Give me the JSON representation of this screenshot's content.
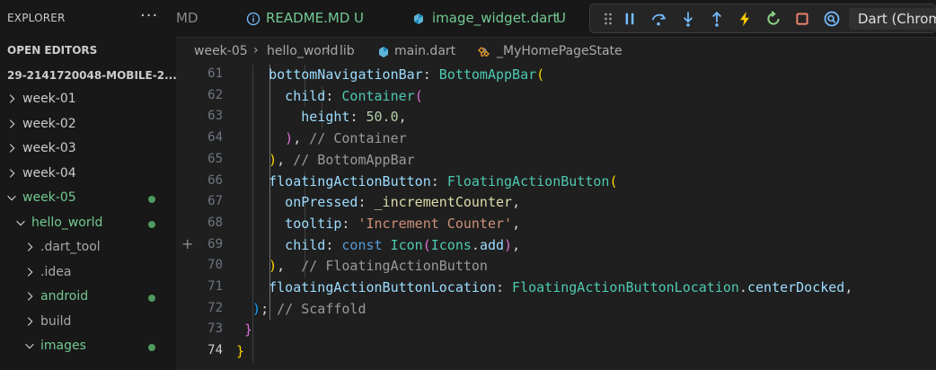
{
  "colors": {
    "sidebar_bg": "#181818",
    "editor_bg": "#1f1f1f",
    "text": "#cccccc",
    "modified_green": "#73c991",
    "dot_green": "#4e9a5f",
    "folder_grey": "#a8a8a8",
    "keyword_blue": "#9cdcfe",
    "class_teal": "#4ec9b0",
    "string_orange": "#ce9178",
    "number_green": "#b5cea8",
    "comment_grey": "#9a9a9a",
    "bracket_gold": "#ffd700",
    "bracket_pink": "#da70d6",
    "bracket_blue": "#179fff",
    "const_blue": "#569cd6",
    "debug_blue": "#75beff",
    "debug_orange": "#ffcc00",
    "debug_green": "#89d185",
    "debug_red": "#f48771"
  },
  "sidebar": {
    "title": "EXPLORER",
    "more_icon": "ellipsis-icon",
    "more_label": "···",
    "open_editors_label": "OPEN EDITORS",
    "root_folder_label": "29-2141720048-MOBILE-2...",
    "items": [
      {
        "label": "week-01",
        "depth": 0,
        "expanded": false,
        "modified": false,
        "color": "#cccccc",
        "dot": false
      },
      {
        "label": "week-02",
        "depth": 0,
        "expanded": false,
        "modified": false,
        "color": "#cccccc",
        "dot": false
      },
      {
        "label": "week-03",
        "depth": 0,
        "expanded": false,
        "modified": false,
        "color": "#cccccc",
        "dot": false
      },
      {
        "label": "week-04",
        "depth": 0,
        "expanded": false,
        "modified": false,
        "color": "#cccccc",
        "dot": false
      },
      {
        "label": "week-05",
        "depth": 0,
        "expanded": true,
        "modified": true,
        "color": "#73c991",
        "dot": true
      },
      {
        "label": "hello_world",
        "depth": 1,
        "expanded": true,
        "modified": true,
        "color": "#73c991",
        "dot": true
      },
      {
        "label": ".dart_tool",
        "depth": 2,
        "expanded": false,
        "modified": false,
        "color": "#a8a8a8",
        "dot": false
      },
      {
        "label": ".idea",
        "depth": 2,
        "expanded": false,
        "modified": false,
        "color": "#a8a8a8",
        "dot": false
      },
      {
        "label": "android",
        "depth": 2,
        "expanded": false,
        "modified": true,
        "color": "#73c991",
        "dot": true
      },
      {
        "label": "build",
        "depth": 2,
        "expanded": false,
        "modified": false,
        "color": "#a8a8a8",
        "dot": false
      },
      {
        "label": "images",
        "depth": 2,
        "expanded": true,
        "modified": true,
        "color": "#73c991",
        "dot": true
      }
    ]
  },
  "tabs": [
    {
      "label": "MD",
      "icon": "",
      "modified_mark": "",
      "color": "#8a8a8a"
    },
    {
      "label": "README.MD",
      "icon": "info-icon",
      "modified_mark": "U",
      "color": "#73c991"
    },
    {
      "label": "image_widget.dart",
      "icon": "dart-icon",
      "modified_mark": "U",
      "color": "#73c991"
    }
  ],
  "debug_toolbar": {
    "target_label": "Dart (Chrome)",
    "buttons": [
      "drag-handle-icon",
      "pause-icon",
      "step-over-icon",
      "step-into-icon",
      "step-out-icon",
      "hot-reload-icon",
      "restart-icon",
      "stop-icon",
      "devtools-icon"
    ]
  },
  "breadcrumb": {
    "parts": [
      "week-05",
      "hello_world",
      "lib",
      "main.dart",
      "_MyHomePageState"
    ]
  },
  "editor": {
    "current_line": 74,
    "lines": [
      {
        "num": 61,
        "tokens": [
          {
            "t": "    bottomNavigationBar",
            "c": "#9cdcfe"
          },
          {
            "t": ": ",
            "c": "#d4d4d4"
          },
          {
            "t": "BottomAppBar",
            "c": "#4ec9b0"
          },
          {
            "t": "(",
            "c": "#ffd700"
          }
        ]
      },
      {
        "num": 62,
        "tokens": [
          {
            "t": "      child",
            "c": "#9cdcfe"
          },
          {
            "t": ": ",
            "c": "#d4d4d4"
          },
          {
            "t": "Container",
            "c": "#4ec9b0"
          },
          {
            "t": "(",
            "c": "#da70d6"
          }
        ]
      },
      {
        "num": 63,
        "tokens": [
          {
            "t": "        height",
            "c": "#9cdcfe"
          },
          {
            "t": ": ",
            "c": "#d4d4d4"
          },
          {
            "t": "50.0",
            "c": "#b5cea8"
          },
          {
            "t": ",",
            "c": "#d4d4d4"
          }
        ]
      },
      {
        "num": 64,
        "tokens": [
          {
            "t": "      )",
            "c": "#da70d6"
          },
          {
            "t": ", ",
            "c": "#d4d4d4"
          },
          {
            "t": "// Container",
            "c": "#9a9a9a"
          }
        ]
      },
      {
        "num": 65,
        "tokens": [
          {
            "t": "    )",
            "c": "#ffd700"
          },
          {
            "t": ", ",
            "c": "#d4d4d4"
          },
          {
            "t": "// BottomAppBar",
            "c": "#9a9a9a"
          }
        ]
      },
      {
        "num": 66,
        "tokens": [
          {
            "t": "    floatingActionButton",
            "c": "#9cdcfe"
          },
          {
            "t": ": ",
            "c": "#d4d4d4"
          },
          {
            "t": "FloatingActionButton",
            "c": "#4ec9b0"
          },
          {
            "t": "(",
            "c": "#ffd700"
          }
        ]
      },
      {
        "num": 67,
        "tokens": [
          {
            "t": "      onPressed",
            "c": "#9cdcfe"
          },
          {
            "t": ": ",
            "c": "#d4d4d4"
          },
          {
            "t": "_incrementCounter",
            "c": "#dcdcaa"
          },
          {
            "t": ",",
            "c": "#d4d4d4"
          }
        ]
      },
      {
        "num": 68,
        "tokens": [
          {
            "t": "      tooltip",
            "c": "#9cdcfe"
          },
          {
            "t": ": ",
            "c": "#d4d4d4"
          },
          {
            "t": "'Increment Counter'",
            "c": "#ce9178"
          },
          {
            "t": ",",
            "c": "#d4d4d4"
          }
        ]
      },
      {
        "num": 69,
        "mark": "+",
        "tokens": [
          {
            "t": "      child",
            "c": "#9cdcfe"
          },
          {
            "t": ": ",
            "c": "#d4d4d4"
          },
          {
            "t": "const ",
            "c": "#569cd6"
          },
          {
            "t": "Icon",
            "c": "#4ec9b0"
          },
          {
            "t": "(",
            "c": "#da70d6"
          },
          {
            "t": "Icons",
            "c": "#4ec9b0"
          },
          {
            "t": ".",
            "c": "#d4d4d4"
          },
          {
            "t": "add",
            "c": "#9cdcfe"
          },
          {
            "t": ")",
            "c": "#da70d6"
          },
          {
            "t": ",",
            "c": "#d4d4d4"
          }
        ]
      },
      {
        "num": 70,
        "tokens": [
          {
            "t": "    )",
            "c": "#ffd700"
          },
          {
            "t": ",  ",
            "c": "#d4d4d4"
          },
          {
            "t": "// FloatingActionButton",
            "c": "#9a9a9a"
          }
        ]
      },
      {
        "num": 71,
        "tokens": [
          {
            "t": "    floatingActionButtonLocation",
            "c": "#9cdcfe"
          },
          {
            "t": ": ",
            "c": "#d4d4d4"
          },
          {
            "t": "FloatingActionButtonLocation",
            "c": "#4ec9b0"
          },
          {
            "t": ".",
            "c": "#d4d4d4"
          },
          {
            "t": "centerDocked",
            "c": "#9cdcfe"
          },
          {
            "t": ",",
            "c": "#d4d4d4"
          }
        ]
      },
      {
        "num": 72,
        "tokens": [
          {
            "t": "  )",
            "c": "#179fff"
          },
          {
            "t": "; ",
            "c": "#d4d4d4"
          },
          {
            "t": "// Scaffold",
            "c": "#9a9a9a"
          }
        ]
      },
      {
        "num": 73,
        "tokens": [
          {
            "t": " }",
            "c": "#da70d6"
          }
        ]
      },
      {
        "num": 74,
        "tokens": [
          {
            "t": "}",
            "c": "#ffd700"
          }
        ]
      }
    ]
  }
}
